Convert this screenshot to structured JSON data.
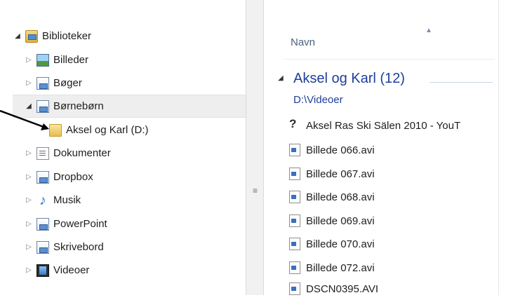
{
  "nav": {
    "items": [
      {
        "label": "Biblioteker",
        "icon": "library-folder-icon",
        "expanded": true
      },
      {
        "label": "Billeder",
        "icon": "pictures-library-icon"
      },
      {
        "label": "Bøger",
        "icon": "document-library-icon"
      },
      {
        "label": "Børnebørn",
        "icon": "document-library-icon",
        "expanded": true,
        "selected": true
      },
      {
        "label": "Aksel og Karl (D:)",
        "icon": "folder-icon"
      },
      {
        "label": "Dokumenter",
        "icon": "documents-library-icon"
      },
      {
        "label": "Dropbox",
        "icon": "document-library-icon"
      },
      {
        "label": "Musik",
        "icon": "music-library-icon"
      },
      {
        "label": "PowerPoint",
        "icon": "document-library-icon"
      },
      {
        "label": "Skrivebord",
        "icon": "document-library-icon"
      },
      {
        "label": "Videoer",
        "icon": "videos-library-icon"
      }
    ]
  },
  "content": {
    "column_header": "Navn",
    "group": {
      "title": "Aksel og Karl (12)",
      "path": "D:\\Videoer"
    },
    "files": [
      {
        "name": "Aksel Ras Ski Sälen 2010 - YouT",
        "icon": "web-link-icon"
      },
      {
        "name": "Billede 066.avi",
        "icon": "video-file-icon"
      },
      {
        "name": "Billede 067.avi",
        "icon": "video-file-icon"
      },
      {
        "name": "Billede 068.avi",
        "icon": "video-file-icon"
      },
      {
        "name": "Billede 069.avi",
        "icon": "video-file-icon"
      },
      {
        "name": "Billede 070.avi",
        "icon": "video-file-icon"
      },
      {
        "name": "Billede 072.avi",
        "icon": "video-file-icon"
      },
      {
        "name": "DSCN0395.AVI",
        "icon": "video-file-icon"
      }
    ]
  },
  "colors": {
    "accent_blue": "#1e3f9a",
    "header_text": "#4c607a",
    "selection_bg": "#eeeeee"
  }
}
